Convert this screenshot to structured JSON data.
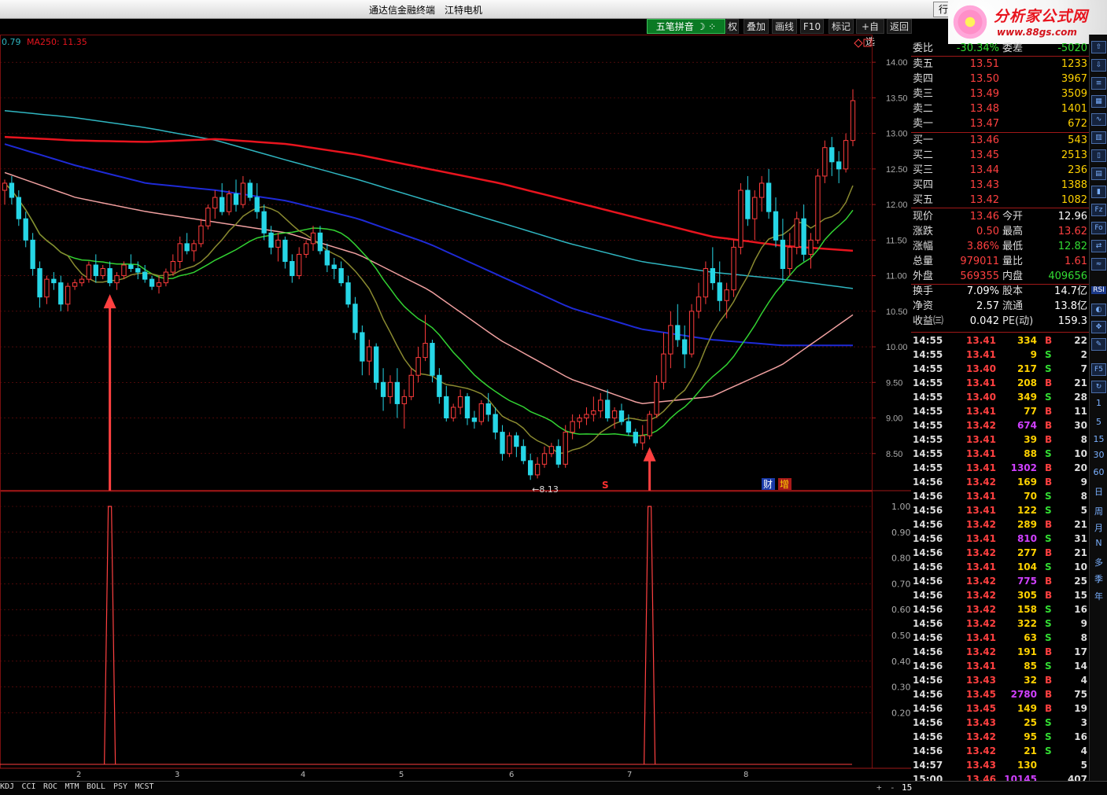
{
  "window": {
    "title_left": "通达信金融终端",
    "title_stock": "江特电机",
    "hangq_button": "行"
  },
  "logo": {
    "text": "分析家公式网",
    "url": "www.88gs.com"
  },
  "toolbar": {
    "pinyin": "五笔拼音",
    "buttons": [
      "权",
      "叠加",
      "画线",
      "F10",
      "标记",
      "+自选",
      "返回"
    ]
  },
  "ma_legend": {
    "prefix": "0.79",
    "ma250": "MA250: 11.35"
  },
  "chart_data": [
    {
      "type": "candlestick",
      "title": "",
      "ylim": [
        8.0,
        14.3
      ],
      "y_ticks": [
        "14.00",
        "13.50",
        "13.00",
        "12.50",
        "12.00",
        "11.50",
        "11.00",
        "10.50",
        "10.00",
        "9.50",
        "9.00",
        "8.50"
      ],
      "x_tick_labels": [
        "2",
        "3",
        "4",
        "5",
        "6",
        "7",
        "8"
      ],
      "low_annotation": "←8.13",
      "markers": {
        "s": "S",
        "cai": "财",
        "zeng": "增"
      },
      "ohlc": [
        [
          12.2,
          12.35,
          12.0,
          12.3
        ],
        [
          12.3,
          12.4,
          12.0,
          12.1
        ],
        [
          12.1,
          12.2,
          11.7,
          11.8
        ],
        [
          11.8,
          11.9,
          11.4,
          11.5
        ],
        [
          11.5,
          11.6,
          11.0,
          11.1
        ],
        [
          11.1,
          11.2,
          10.55,
          10.7
        ],
        [
          10.7,
          11.0,
          10.6,
          10.95
        ],
        [
          10.95,
          11.05,
          10.8,
          10.9
        ],
        [
          10.9,
          11.0,
          10.5,
          10.6
        ],
        [
          10.6,
          10.9,
          10.5,
          10.85
        ],
        [
          10.85,
          10.95,
          10.8,
          10.9
        ],
        [
          10.9,
          11.0,
          10.85,
          10.95
        ],
        [
          10.95,
          11.2,
          10.9,
          11.15
        ],
        [
          11.15,
          11.3,
          10.9,
          11.0
        ],
        [
          11.0,
          11.15,
          10.95,
          11.1
        ],
        [
          11.1,
          11.2,
          10.85,
          10.9
        ],
        [
          10.9,
          11.05,
          10.8,
          11.0
        ],
        [
          11.0,
          11.2,
          10.95,
          11.15
        ],
        [
          11.15,
          11.3,
          11.05,
          11.1
        ],
        [
          11.1,
          11.2,
          10.95,
          11.05
        ],
        [
          11.05,
          11.15,
          10.9,
          10.95
        ],
        [
          10.95,
          11.0,
          10.8,
          10.85
        ],
        [
          10.85,
          11.0,
          10.75,
          10.9
        ],
        [
          10.9,
          11.1,
          10.85,
          11.05
        ],
        [
          11.05,
          11.3,
          11.0,
          11.2
        ],
        [
          11.2,
          11.55,
          11.1,
          11.45
        ],
        [
          11.45,
          11.6,
          11.3,
          11.35
        ],
        [
          11.35,
          11.5,
          11.2,
          11.45
        ],
        [
          11.45,
          11.8,
          11.4,
          11.7
        ],
        [
          11.7,
          12.0,
          11.65,
          11.95
        ],
        [
          11.95,
          12.2,
          11.8,
          12.1
        ],
        [
          12.1,
          12.3,
          11.85,
          11.9
        ],
        [
          11.9,
          12.2,
          11.85,
          12.15
        ],
        [
          12.15,
          12.35,
          11.9,
          12.0
        ],
        [
          12.0,
          12.4,
          11.95,
          12.3
        ],
        [
          12.3,
          12.35,
          12.05,
          12.1
        ],
        [
          12.1,
          12.3,
          11.8,
          11.9
        ],
        [
          11.9,
          12.0,
          11.5,
          11.6
        ],
        [
          11.6,
          11.7,
          11.3,
          11.4
        ],
        [
          11.4,
          11.6,
          11.2,
          11.5
        ],
        [
          11.5,
          11.55,
          11.1,
          11.2
        ],
        [
          11.2,
          11.3,
          10.9,
          11.0
        ],
        [
          11.0,
          11.4,
          10.95,
          11.3
        ],
        [
          11.3,
          11.5,
          11.25,
          11.45
        ],
        [
          11.45,
          11.7,
          11.35,
          11.6
        ],
        [
          11.6,
          11.7,
          11.3,
          11.35
        ],
        [
          11.35,
          11.45,
          11.05,
          11.15
        ],
        [
          11.15,
          11.25,
          10.95,
          11.1
        ],
        [
          11.1,
          11.2,
          10.85,
          10.9
        ],
        [
          10.9,
          11.0,
          10.55,
          10.6
        ],
        [
          10.6,
          10.7,
          10.1,
          10.2
        ],
        [
          10.2,
          10.3,
          9.6,
          9.8
        ],
        [
          9.8,
          10.1,
          9.6,
          10.0
        ],
        [
          10.0,
          10.05,
          9.4,
          9.5
        ],
        [
          9.5,
          9.7,
          9.1,
          9.3
        ],
        [
          9.3,
          9.6,
          9.2,
          9.5
        ],
        [
          9.5,
          9.7,
          9.0,
          9.2
        ],
        [
          9.2,
          9.4,
          8.85,
          9.3
        ],
        [
          9.3,
          9.7,
          9.25,
          9.6
        ],
        [
          9.6,
          10.0,
          9.5,
          9.85
        ],
        [
          9.85,
          10.45,
          9.8,
          10.05
        ],
        [
          10.05,
          10.1,
          9.5,
          9.6
        ],
        [
          9.6,
          9.7,
          9.2,
          9.3
        ],
        [
          9.3,
          9.45,
          8.95,
          9.0
        ],
        [
          9.0,
          9.2,
          8.95,
          9.15
        ],
        [
          9.15,
          9.4,
          9.05,
          9.3
        ],
        [
          9.3,
          9.35,
          8.9,
          9.0
        ],
        [
          9.0,
          9.1,
          8.85,
          8.95
        ],
        [
          8.95,
          9.25,
          8.9,
          9.2
        ],
        [
          9.2,
          9.35,
          8.95,
          9.05
        ],
        [
          9.05,
          9.15,
          8.7,
          8.8
        ],
        [
          8.8,
          8.9,
          8.4,
          8.5
        ],
        [
          8.5,
          8.8,
          8.45,
          8.75
        ],
        [
          8.75,
          8.8,
          8.45,
          8.6
        ],
        [
          8.6,
          8.7,
          8.35,
          8.4
        ],
        [
          8.4,
          8.5,
          8.13,
          8.2
        ],
        [
          8.2,
          8.45,
          8.15,
          8.35
        ],
        [
          8.35,
          8.6,
          8.3,
          8.5
        ],
        [
          8.5,
          8.65,
          8.45,
          8.6
        ],
        [
          8.6,
          8.7,
          8.3,
          8.35
        ],
        [
          8.35,
          8.9,
          8.3,
          8.8
        ],
        [
          8.8,
          9.05,
          8.7,
          8.95
        ],
        [
          8.95,
          9.05,
          8.85,
          9.0
        ],
        [
          9.0,
          9.15,
          8.9,
          9.05
        ],
        [
          9.05,
          9.3,
          8.95,
          9.1
        ],
        [
          9.1,
          9.35,
          9.0,
          9.25
        ],
        [
          9.25,
          9.4,
          8.95,
          9.0
        ],
        [
          9.0,
          9.15,
          8.85,
          9.1
        ],
        [
          9.1,
          9.2,
          8.9,
          8.95
        ],
        [
          8.95,
          9.05,
          8.75,
          8.8
        ],
        [
          8.8,
          8.85,
          8.6,
          8.65
        ],
        [
          8.65,
          8.9,
          8.55,
          8.75
        ],
        [
          8.75,
          9.1,
          8.7,
          9.05
        ],
        [
          9.05,
          9.6,
          9.0,
          9.5
        ],
        [
          9.5,
          10.2,
          9.4,
          9.9
        ],
        [
          9.9,
          10.5,
          9.7,
          10.3
        ],
        [
          10.3,
          10.6,
          10.0,
          10.1
        ],
        [
          10.1,
          10.3,
          9.7,
          9.9
        ],
        [
          9.9,
          10.6,
          9.85,
          10.5
        ],
        [
          10.5,
          10.9,
          10.4,
          10.7
        ],
        [
          10.7,
          11.2,
          10.6,
          11.1
        ],
        [
          11.1,
          11.4,
          10.8,
          10.9
        ],
        [
          10.9,
          11.2,
          10.5,
          10.65
        ],
        [
          10.65,
          10.9,
          10.4,
          10.8
        ],
        [
          10.8,
          11.5,
          10.7,
          11.4
        ],
        [
          11.4,
          12.3,
          11.3,
          12.2
        ],
        [
          12.2,
          12.4,
          11.7,
          11.8
        ],
        [
          11.8,
          12.2,
          11.5,
          12.1
        ],
        [
          12.1,
          12.4,
          11.9,
          12.3
        ],
        [
          12.3,
          12.5,
          11.8,
          11.9
        ],
        [
          11.9,
          12.1,
          11.4,
          11.5
        ],
        [
          11.5,
          11.8,
          10.9,
          11.1
        ],
        [
          11.1,
          11.6,
          11.0,
          11.4
        ],
        [
          11.4,
          11.9,
          11.3,
          11.8
        ],
        [
          11.8,
          12.0,
          11.2,
          11.3
        ],
        [
          11.3,
          11.6,
          11.1,
          11.5
        ],
        [
          11.5,
          12.5,
          11.45,
          12.4
        ],
        [
          12.4,
          12.9,
          12.3,
          12.8
        ],
        [
          12.8,
          12.95,
          12.4,
          12.6
        ],
        [
          12.6,
          12.75,
          12.3,
          12.5
        ],
        [
          12.5,
          13.0,
          12.45,
          12.9
        ],
        [
          12.9,
          13.62,
          12.82,
          13.46
        ]
      ]
    },
    {
      "type": "signal",
      "title": "",
      "ylim": [
        0,
        1.0
      ],
      "y_ticks": [
        "1.00",
        "0.90",
        "0.80",
        "0.70",
        "0.60",
        "0.50",
        "0.40",
        "0.30",
        "0.20"
      ],
      "signal_bars": [
        15,
        92
      ]
    }
  ],
  "quote": {
    "weibi": {
      "label": "委比",
      "value": "-30.34%",
      "label2": "委差",
      "value2": "-5020"
    },
    "asks": [
      {
        "label": "卖五",
        "price": "13.51",
        "vol": "1233"
      },
      {
        "label": "卖四",
        "price": "13.50",
        "vol": "3967"
      },
      {
        "label": "卖三",
        "price": "13.49",
        "vol": "3509"
      },
      {
        "label": "卖二",
        "price": "13.48",
        "vol": "1401"
      },
      {
        "label": "卖一",
        "price": "13.47",
        "vol": "672"
      }
    ],
    "bids": [
      {
        "label": "买一",
        "price": "13.46",
        "vol": "543"
      },
      {
        "label": "买二",
        "price": "13.45",
        "vol": "2513"
      },
      {
        "label": "买三",
        "price": "13.44",
        "vol": "236"
      },
      {
        "label": "买四",
        "price": "13.43",
        "vol": "1388"
      },
      {
        "label": "买五",
        "price": "13.42",
        "vol": "1082"
      }
    ],
    "stats": [
      {
        "l1": "现价",
        "v1": "13.46",
        "l2": "今开",
        "v2": "12.96",
        "c1": "#ff4040",
        "c2": "#ffffff"
      },
      {
        "l1": "涨跌",
        "v1": "0.50",
        "l2": "最高",
        "v2": "13.62",
        "c1": "#ff4040",
        "c2": "#ff4040"
      },
      {
        "l1": "涨幅",
        "v1": "3.86%",
        "l2": "最低",
        "v2": "12.82",
        "c1": "#ff4040",
        "c2": "#33dd33"
      },
      {
        "l1": "总量",
        "v1": "979011",
        "l2": "量比",
        "v2": "1.61",
        "c1": "#ff4040",
        "c2": "#ff4040"
      },
      {
        "l1": "外盘",
        "v1": "569355",
        "l2": "内盘",
        "v2": "409656",
        "c1": "#ff4040",
        "c2": "#33dd33"
      },
      {
        "l1": "换手",
        "v1": "7.09%",
        "l2": "股本",
        "v2": "14.7亿",
        "c1": "#ffffff",
        "c2": "#ffffff"
      },
      {
        "l1": "净资",
        "v1": "2.57",
        "l2": "流通",
        "v2": "13.8亿",
        "c1": "#ffffff",
        "c2": "#ffffff"
      },
      {
        "l1": "收益㈢",
        "v1": "0.042",
        "l2": "PE(动)",
        "v2": "159.3",
        "c1": "#ffffff",
        "c2": "#ffffff"
      }
    ]
  },
  "ticks": [
    [
      "14:55",
      "13.41",
      "334",
      "B",
      "22"
    ],
    [
      "14:55",
      "13.41",
      "9",
      "S",
      "2"
    ],
    [
      "14:55",
      "13.40",
      "217",
      "S",
      "7"
    ],
    [
      "14:55",
      "13.41",
      "208",
      "B",
      "21"
    ],
    [
      "14:55",
      "13.40",
      "349",
      "S",
      "28"
    ],
    [
      "14:55",
      "13.41",
      "77",
      "B",
      "11"
    ],
    [
      "14:55",
      "13.42",
      "674",
      "B",
      "30"
    ],
    [
      "14:55",
      "13.41",
      "39",
      "B",
      "8"
    ],
    [
      "14:55",
      "13.41",
      "88",
      "S",
      "10"
    ],
    [
      "14:55",
      "13.41",
      "1302",
      "B",
      "20"
    ],
    [
      "14:56",
      "13.42",
      "169",
      "B",
      "9"
    ],
    [
      "14:56",
      "13.41",
      "70",
      "S",
      "8"
    ],
    [
      "14:56",
      "13.41",
      "122",
      "S",
      "5"
    ],
    [
      "14:56",
      "13.42",
      "289",
      "B",
      "21"
    ],
    [
      "14:56",
      "13.41",
      "810",
      "S",
      "31"
    ],
    [
      "14:56",
      "13.42",
      "277",
      "B",
      "21"
    ],
    [
      "14:56",
      "13.41",
      "104",
      "S",
      "10"
    ],
    [
      "14:56",
      "13.42",
      "775",
      "B",
      "25"
    ],
    [
      "14:56",
      "13.42",
      "305",
      "B",
      "15"
    ],
    [
      "14:56",
      "13.42",
      "158",
      "S",
      "16"
    ],
    [
      "14:56",
      "13.42",
      "322",
      "S",
      "9"
    ],
    [
      "14:56",
      "13.41",
      "63",
      "S",
      "8"
    ],
    [
      "14:56",
      "13.42",
      "191",
      "B",
      "17"
    ],
    [
      "14:56",
      "13.41",
      "85",
      "S",
      "14"
    ],
    [
      "14:56",
      "13.43",
      "32",
      "B",
      "4"
    ],
    [
      "14:56",
      "13.45",
      "2780",
      "B",
      "75"
    ],
    [
      "14:56",
      "13.45",
      "149",
      "B",
      "19"
    ],
    [
      "14:56",
      "13.43",
      "25",
      "S",
      "3"
    ],
    [
      "14:56",
      "13.42",
      "95",
      "S",
      "16"
    ],
    [
      "14:56",
      "13.42",
      "21",
      "S",
      "4"
    ],
    [
      "14:57",
      "13.43",
      "130",
      "",
      "5"
    ],
    [
      "15:00",
      "13.46",
      "10145",
      "",
      "407"
    ]
  ],
  "sidebar": {
    "tools": [
      "RSI",
      "1",
      "5",
      "15",
      "30",
      "60",
      "日",
      "周",
      "月",
      "N",
      "多",
      "季",
      "年"
    ]
  },
  "indicators": [
    "KDJ",
    "CCI",
    "ROC",
    "MTM",
    "BOLL",
    "PSY",
    "MCST"
  ],
  "bottom_right": [
    "+",
    "-",
    "15"
  ],
  "colors": {
    "up": "#ff3c3c",
    "down": "#26d6e6",
    "ma_red": "#e8141e",
    "ma_cyan": "#2fb5c0",
    "ma_blue": "#1e2ad6",
    "ma_pink": "#f0a0a0",
    "ma_green": "#32d232",
    "ma_olive": "#8a8a30",
    "grid": "#7a0f0f",
    "arrow": "#ff4040"
  }
}
